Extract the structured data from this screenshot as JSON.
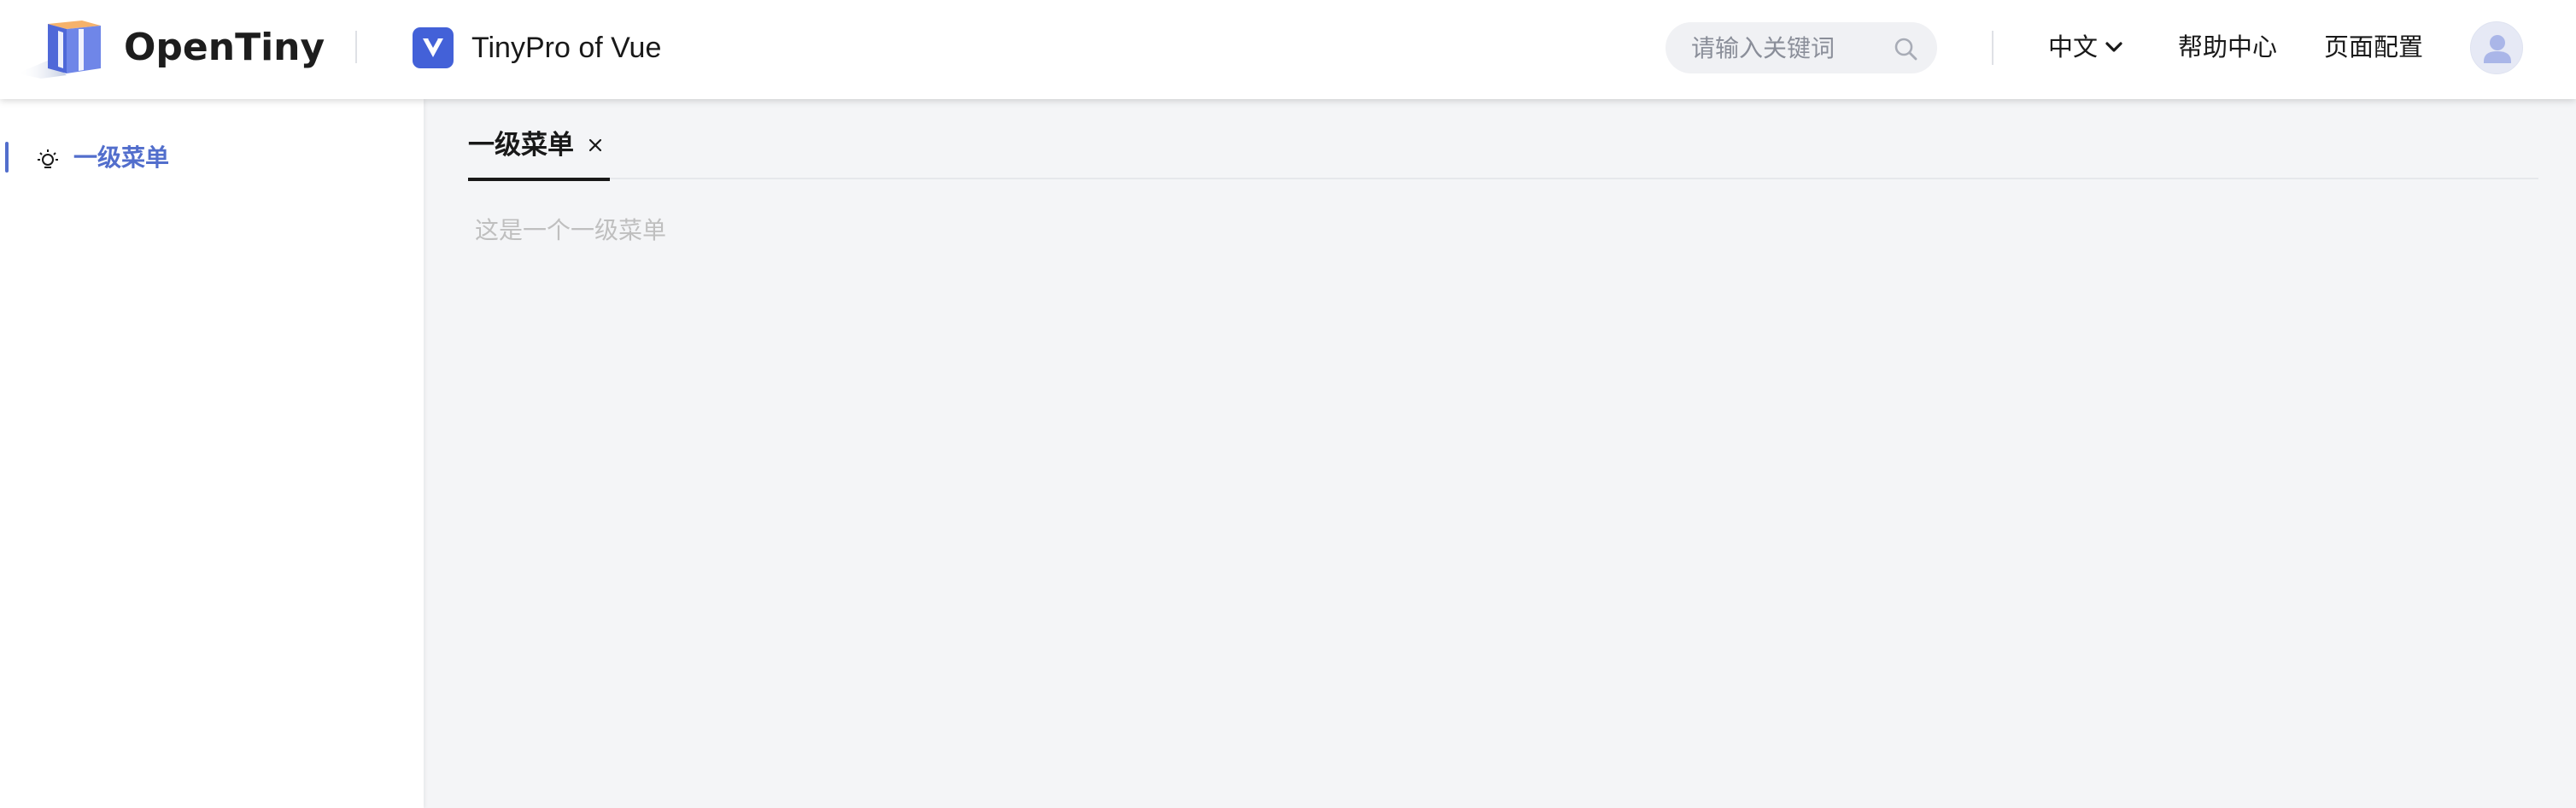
{
  "header": {
    "brand": "OpenTiny",
    "product": "TinyPro of Vue",
    "search": {
      "placeholder": "请输入关键词",
      "value": ""
    },
    "nav": {
      "language": "中文",
      "help": "帮助中心",
      "page_config": "页面配置"
    },
    "icons": {
      "logo": "opentiny-logo-icon",
      "product": "vue-badge-icon",
      "search": "search-icon",
      "language_arrow": "chevron-down-icon",
      "avatar": "user-avatar-icon"
    }
  },
  "sidebar": {
    "items": [
      {
        "label": "一级菜单",
        "icon": "lightbulb-icon",
        "active": true
      }
    ]
  },
  "tabs": [
    {
      "label": "一级菜单",
      "active": true,
      "closable": true
    }
  ],
  "content": {
    "text": "这是一个一级菜单"
  },
  "colors": {
    "accent": "#526ecc",
    "vue_badge": "#4361d8",
    "page_background": "#f4f5f7"
  }
}
